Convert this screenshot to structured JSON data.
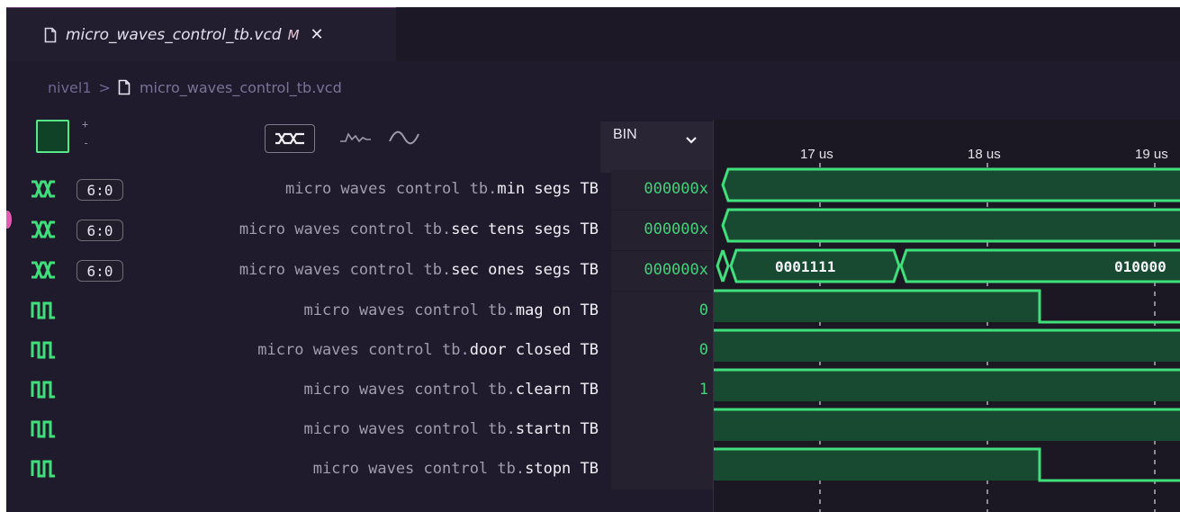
{
  "tab": {
    "title": "micro_waves_control_tb.vcd",
    "modified": "M",
    "close": "✕"
  },
  "breadcrumb": {
    "folder": "nivel1",
    "separator": ">",
    "file": "micro_waves_control_tb.vcd"
  },
  "toolbar": {
    "zoom_in": "+",
    "zoom_out": "-",
    "radix": "BIN"
  },
  "icons": {
    "file": "file-icon",
    "bus": "bus-icon",
    "bit": "bit-waveform-icon",
    "step": "step-format-icon",
    "analog": "analog-format-icon",
    "chevron": "chevron-down-icon"
  },
  "colors": {
    "waveform": "#3fe07b",
    "waveform_fill": "#174a31",
    "background": "#1f1b2c",
    "value_text": "#41d27a"
  },
  "signals": [
    {
      "prefix": "micro waves control tb.",
      "leaf": "min segs TB",
      "width": "6:0",
      "value": "000000x",
      "type": "bus"
    },
    {
      "prefix": "micro waves control tb.",
      "leaf": "sec tens segs TB",
      "width": "6:0",
      "value": "000000x",
      "type": "bus"
    },
    {
      "prefix": "micro waves control tb.",
      "leaf": "sec ones segs TB",
      "width": "6:0",
      "value": "000000x",
      "type": "bus"
    },
    {
      "prefix": "micro waves control tb.",
      "leaf": "mag on TB",
      "width": "",
      "value": "0",
      "type": "bit"
    },
    {
      "prefix": "micro waves control tb.",
      "leaf": "door closed TB",
      "width": "",
      "value": "0",
      "type": "bit"
    },
    {
      "prefix": "micro waves control tb.",
      "leaf": "clearn TB",
      "width": "",
      "value": "1",
      "type": "bit"
    },
    {
      "prefix": "micro waves control tb.",
      "leaf": "startn TB",
      "width": "",
      "value": "",
      "type": "bit"
    },
    {
      "prefix": "micro waves control tb.",
      "leaf": "stopn TB",
      "width": "",
      "value": "",
      "type": "bit"
    }
  ],
  "timeline": {
    "ticks": [
      "17 us",
      "18 us",
      "19 us"
    ],
    "bus_labels": [
      "0001111",
      "010000"
    ]
  }
}
